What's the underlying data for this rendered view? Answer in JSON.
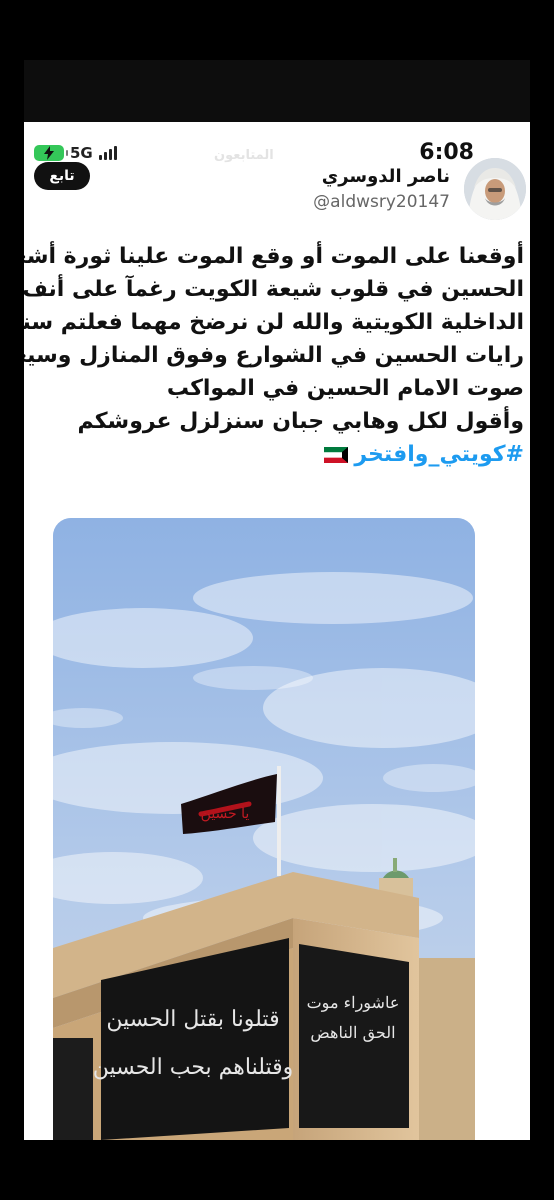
{
  "status_bar": {
    "battery_label": "",
    "network": "5G",
    "time": "6:08"
  },
  "follow_button": {
    "label": "تابع"
  },
  "background_header_text": "المتابعون",
  "author": {
    "display_name": "ناصر الدوسري",
    "handle": "@aldwsry20147"
  },
  "tweet": {
    "lines": [
      "أوقعنا على الموت أو وقع الموت علينا ثورة أشعلها",
      "الحسين في قلوب شيعة الكويت رغمآ على أنف وزارة",
      "الداخلية الكويتية والله لن نرضخ مهما فعلتم سنرفع",
      "رايات الحسين في الشوارع وفوق المنازل وسيعلوا",
      "صوت الامام الحسين في المواكب",
      "وأقول لكل وهابي جبان سنزلزل عروشكم"
    ],
    "hashtag": "#كويتي_وافتخر"
  },
  "media": {
    "flag_text": "يا حسين",
    "banner_left_lines": [
      "قتلونا بقتل الحسين",
      "وقتلناهم بحب الحسين"
    ],
    "banner_right_lines": [
      "عاشوراء موت",
      "الحق الناهض"
    ]
  },
  "colors": {
    "hashtag": "#1d9bf0",
    "battery": "#34c759",
    "sky": "#a6c3ea",
    "banner": "#141414"
  }
}
